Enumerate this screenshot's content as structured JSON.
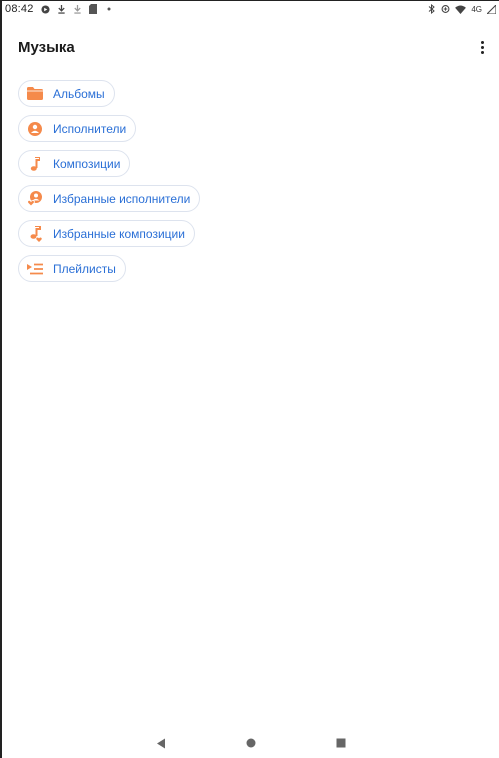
{
  "status_bar": {
    "time": "08:42",
    "network_label": "4G"
  },
  "app_bar": {
    "title": "Музыка",
    "overflow_icon": "more-vert-icon"
  },
  "menu_items": [
    {
      "label": "Альбомы",
      "icon": "folder-icon"
    },
    {
      "label": "Исполнители",
      "icon": "person-icon"
    },
    {
      "label": "Композиции",
      "icon": "music-note-icon"
    },
    {
      "label": "Избранные исполнители",
      "icon": "favorite-artist-icon"
    },
    {
      "label": "Избранные композиции",
      "icon": "favorite-song-icon"
    },
    {
      "label": "Плейлисты",
      "icon": "playlist-icon"
    }
  ],
  "nav_bar": {
    "back_icon": "back-triangle-icon",
    "home_icon": "home-circle-icon",
    "recents_icon": "recents-square-icon"
  },
  "colors": {
    "accent_orange": "#f58a4b",
    "chip_text_blue": "#2a6fd6",
    "chip_border": "#dde3ee"
  }
}
